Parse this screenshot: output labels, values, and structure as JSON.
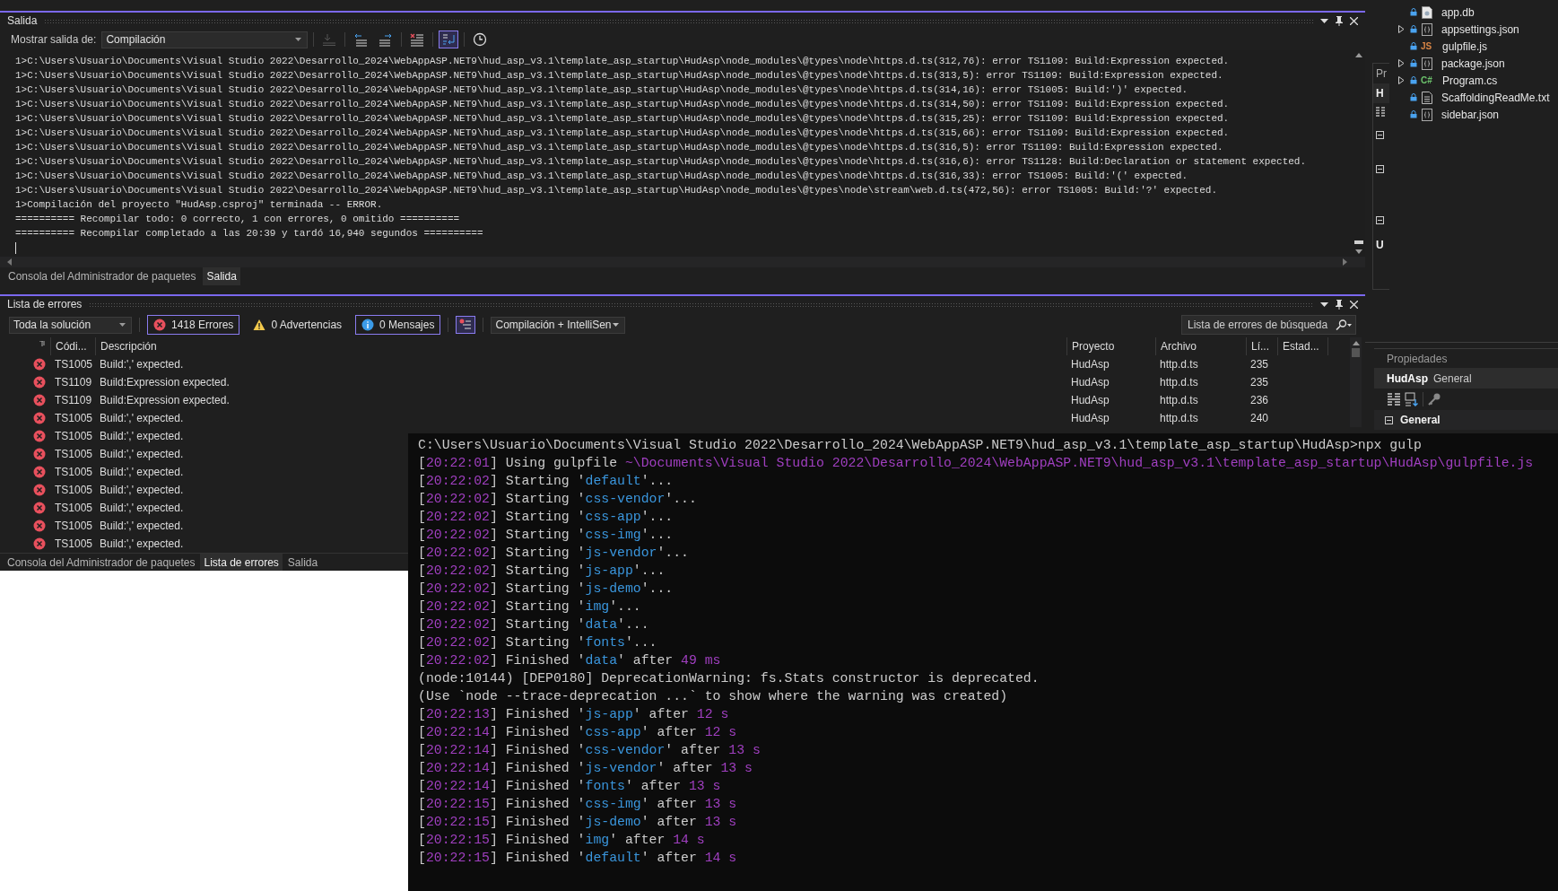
{
  "output_panel": {
    "title": "Salida",
    "show_from_label": "Mostrar salida de:",
    "source": "Compilación",
    "toolbar": [
      {
        "kind": "find-source",
        "selected": false,
        "disabled": true
      },
      {
        "kind": "prev-message",
        "selected": false,
        "disabled": false
      },
      {
        "kind": "next-message",
        "selected": false,
        "disabled": false
      },
      {
        "kind": "clear-all",
        "selected": false,
        "disabled": false
      },
      {
        "kind": "word-wrap",
        "selected": true,
        "disabled": false
      },
      {
        "kind": "timestamp",
        "selected": false,
        "disabled": false
      }
    ],
    "lines": [
      "1>C:\\Users\\Usuario\\Documents\\Visual Studio 2022\\Desarrollo_2024\\WebAppASP.NET9\\hud_asp_v3.1\\template_asp_startup\\HudAsp\\node_modules\\@types\\node\\https.d.ts(312,76): error TS1109: Build:Expression expected.",
      "1>C:\\Users\\Usuario\\Documents\\Visual Studio 2022\\Desarrollo_2024\\WebAppASP.NET9\\hud_asp_v3.1\\template_asp_startup\\HudAsp\\node_modules\\@types\\node\\https.d.ts(313,5): error TS1109: Build:Expression expected.",
      "1>C:\\Users\\Usuario\\Documents\\Visual Studio 2022\\Desarrollo_2024\\WebAppASP.NET9\\hud_asp_v3.1\\template_asp_startup\\HudAsp\\node_modules\\@types\\node\\https.d.ts(314,16): error TS1005: Build:')' expected.",
      "1>C:\\Users\\Usuario\\Documents\\Visual Studio 2022\\Desarrollo_2024\\WebAppASP.NET9\\hud_asp_v3.1\\template_asp_startup\\HudAsp\\node_modules\\@types\\node\\https.d.ts(314,50): error TS1109: Build:Expression expected.",
      "1>C:\\Users\\Usuario\\Documents\\Visual Studio 2022\\Desarrollo_2024\\WebAppASP.NET9\\hud_asp_v3.1\\template_asp_startup\\HudAsp\\node_modules\\@types\\node\\https.d.ts(315,25): error TS1109: Build:Expression expected.",
      "1>C:\\Users\\Usuario\\Documents\\Visual Studio 2022\\Desarrollo_2024\\WebAppASP.NET9\\hud_asp_v3.1\\template_asp_startup\\HudAsp\\node_modules\\@types\\node\\https.d.ts(315,66): error TS1109: Build:Expression expected.",
      "1>C:\\Users\\Usuario\\Documents\\Visual Studio 2022\\Desarrollo_2024\\WebAppASP.NET9\\hud_asp_v3.1\\template_asp_startup\\HudAsp\\node_modules\\@types\\node\\https.d.ts(316,5): error TS1109: Build:Expression expected.",
      "1>C:\\Users\\Usuario\\Documents\\Visual Studio 2022\\Desarrollo_2024\\WebAppASP.NET9\\hud_asp_v3.1\\template_asp_startup\\HudAsp\\node_modules\\@types\\node\\https.d.ts(316,6): error TS1128: Build:Declaration or statement expected.",
      "1>C:\\Users\\Usuario\\Documents\\Visual Studio 2022\\Desarrollo_2024\\WebAppASP.NET9\\hud_asp_v3.1\\template_asp_startup\\HudAsp\\node_modules\\@types\\node\\https.d.ts(316,33): error TS1005: Build:'(' expected.",
      "1>C:\\Users\\Usuario\\Documents\\Visual Studio 2022\\Desarrollo_2024\\WebAppASP.NET9\\hud_asp_v3.1\\template_asp_startup\\HudAsp\\node_modules\\@types\\node\\stream\\web.d.ts(472,56): error TS1005: Build:'?' expected.",
      "1>Compilación del proyecto \"HudAsp.csproj\" terminada -- ERROR.",
      "========== Recompilar todo: 0 correcto, 1 con errores, 0 omitido ==========",
      "========== Recompilar completado a las 20:39 y tardó 16,940 segundos =========="
    ],
    "tabs": [
      {
        "label": "Consola del Administrador de paquetes",
        "selected": false
      },
      {
        "label": "Salida",
        "selected": true
      }
    ]
  },
  "error_list": {
    "title": "Lista de errores",
    "scope": "Toda la solución",
    "filters": [
      {
        "kind": "error",
        "label": "1418 Errores",
        "selected": true
      },
      {
        "kind": "warning",
        "label": "0 Advertencias",
        "selected": false
      },
      {
        "kind": "info",
        "label": "0 Mensajes",
        "selected": true
      }
    ],
    "filter_toggle_selected": true,
    "source": "Compilación + IntelliSen",
    "search_placeholder": "Lista de errores de búsqueda",
    "columns": [
      "Códi...",
      "Descripción",
      "Proyecto",
      "Archivo",
      "Lí...",
      "Estad..."
    ],
    "rows": [
      {
        "kind": "error",
        "code": "TS1005",
        "description": "Build:',' expected.",
        "project": "HudAsp",
        "file": "http.d.ts",
        "line": "235"
      },
      {
        "kind": "error",
        "code": "TS1109",
        "description": "Build:Expression expected.",
        "project": "HudAsp",
        "file": "http.d.ts",
        "line": "235"
      },
      {
        "kind": "error",
        "code": "TS1109",
        "description": "Build:Expression expected.",
        "project": "HudAsp",
        "file": "http.d.ts",
        "line": "236"
      },
      {
        "kind": "error",
        "code": "TS1005",
        "description": "Build:',' expected.",
        "project": "HudAsp",
        "file": "http.d.ts",
        "line": "240"
      },
      {
        "kind": "error",
        "code": "TS1005",
        "description": "Build:',' expected."
      },
      {
        "kind": "error",
        "code": "TS1005",
        "description": "Build:',' expected."
      },
      {
        "kind": "error",
        "code": "TS1005",
        "description": "Build:',' expected."
      },
      {
        "kind": "error",
        "code": "TS1005",
        "description": "Build:',' expected."
      },
      {
        "kind": "error",
        "code": "TS1005",
        "description": "Build:',' expected."
      },
      {
        "kind": "error",
        "code": "TS1005",
        "description": "Build:',' expected."
      },
      {
        "kind": "error",
        "code": "TS1005",
        "description": "Build:',' expected."
      }
    ],
    "tabs": [
      {
        "label": "Consola del Administrador de paquetes",
        "selected": false
      },
      {
        "label": "Lista de errores",
        "selected": true
      },
      {
        "label": "Salida",
        "selected": false
      }
    ]
  },
  "solution_explorer": {
    "items": [
      {
        "name": "app.db",
        "kind": "db",
        "has_children": false,
        "locked": true
      },
      {
        "name": "appsettings.json",
        "kind": "json",
        "has_children": true,
        "locked": true
      },
      {
        "name": "gulpfile.js",
        "kind": "js",
        "badge": "JS",
        "has_children": false,
        "locked": true
      },
      {
        "name": "package.json",
        "kind": "json",
        "has_children": true,
        "locked": true
      },
      {
        "name": "Program.cs",
        "kind": "cs",
        "badge": "C#",
        "has_children": true,
        "locked": true
      },
      {
        "name": "ScaffoldingReadMe.txt",
        "kind": "txt",
        "has_children": false,
        "locked": true
      },
      {
        "name": "sidebar.json",
        "kind": "json",
        "has_children": false,
        "locked": true
      }
    ]
  },
  "covered_panel": {
    "title": "Pr",
    "labels": [
      "H",
      "U"
    ]
  },
  "properties": {
    "title": "Propiedades",
    "object": "HudAsp",
    "object_type": "General",
    "category": "General"
  },
  "terminal": {
    "lines": [
      {
        "parts": [
          {
            "text": "C:\\Users\\Usuario\\Documents\\Visual Studio 2022\\Desarrollo_2024\\WebAppASP.NET9\\hud_asp_v3.1\\template_asp_startup\\HudAsp>npx gulp",
            "kind": "plain"
          }
        ]
      },
      {
        "parts": [
          {
            "text": "[",
            "kind": "plain"
          },
          {
            "text": "20:22:01",
            "kind": "time"
          },
          {
            "text": "] Using gulpfile ",
            "kind": "plain"
          },
          {
            "text": "~\\Documents\\Visual Studio 2022\\Desarrollo_2024\\WebAppASP.NET9\\hud_asp_v3.1\\template_asp_startup\\HudAsp\\gulpfile.js",
            "kind": "path"
          }
        ]
      },
      {
        "parts": [
          {
            "text": "[",
            "kind": "plain"
          },
          {
            "text": "20:22:02",
            "kind": "time"
          },
          {
            "text": "] Starting '",
            "kind": "plain"
          },
          {
            "text": "default",
            "kind": "task"
          },
          {
            "text": "'...",
            "kind": "plain"
          }
        ]
      },
      {
        "parts": [
          {
            "text": "[",
            "kind": "plain"
          },
          {
            "text": "20:22:02",
            "kind": "time"
          },
          {
            "text": "] Starting '",
            "kind": "plain"
          },
          {
            "text": "css-vendor",
            "kind": "task"
          },
          {
            "text": "'...",
            "kind": "plain"
          }
        ]
      },
      {
        "parts": [
          {
            "text": "[",
            "kind": "plain"
          },
          {
            "text": "20:22:02",
            "kind": "time"
          },
          {
            "text": "] Starting '",
            "kind": "plain"
          },
          {
            "text": "css-app",
            "kind": "task"
          },
          {
            "text": "'...",
            "kind": "plain"
          }
        ]
      },
      {
        "parts": [
          {
            "text": "[",
            "kind": "plain"
          },
          {
            "text": "20:22:02",
            "kind": "time"
          },
          {
            "text": "] Starting '",
            "kind": "plain"
          },
          {
            "text": "css-img",
            "kind": "task"
          },
          {
            "text": "'...",
            "kind": "plain"
          }
        ]
      },
      {
        "parts": [
          {
            "text": "[",
            "kind": "plain"
          },
          {
            "text": "20:22:02",
            "kind": "time"
          },
          {
            "text": "] Starting '",
            "kind": "plain"
          },
          {
            "text": "js-vendor",
            "kind": "task"
          },
          {
            "text": "'...",
            "kind": "plain"
          }
        ]
      },
      {
        "parts": [
          {
            "text": "[",
            "kind": "plain"
          },
          {
            "text": "20:22:02",
            "kind": "time"
          },
          {
            "text": "] Starting '",
            "kind": "plain"
          },
          {
            "text": "js-app",
            "kind": "task"
          },
          {
            "text": "'...",
            "kind": "plain"
          }
        ]
      },
      {
        "parts": [
          {
            "text": "[",
            "kind": "plain"
          },
          {
            "text": "20:22:02",
            "kind": "time"
          },
          {
            "text": "] Starting '",
            "kind": "plain"
          },
          {
            "text": "js-demo",
            "kind": "task"
          },
          {
            "text": "'...",
            "kind": "plain"
          }
        ]
      },
      {
        "parts": [
          {
            "text": "[",
            "kind": "plain"
          },
          {
            "text": "20:22:02",
            "kind": "time"
          },
          {
            "text": "] Starting '",
            "kind": "plain"
          },
          {
            "text": "img",
            "kind": "task"
          },
          {
            "text": "'...",
            "kind": "plain"
          }
        ]
      },
      {
        "parts": [
          {
            "text": "[",
            "kind": "plain"
          },
          {
            "text": "20:22:02",
            "kind": "time"
          },
          {
            "text": "] Starting '",
            "kind": "plain"
          },
          {
            "text": "data",
            "kind": "task"
          },
          {
            "text": "'...",
            "kind": "plain"
          }
        ]
      },
      {
        "parts": [
          {
            "text": "[",
            "kind": "plain"
          },
          {
            "text": "20:22:02",
            "kind": "time"
          },
          {
            "text": "] Starting '",
            "kind": "plain"
          },
          {
            "text": "fonts",
            "kind": "task"
          },
          {
            "text": "'...",
            "kind": "plain"
          }
        ]
      },
      {
        "parts": [
          {
            "text": "[",
            "kind": "plain"
          },
          {
            "text": "20:22:02",
            "kind": "time"
          },
          {
            "text": "] Finished '",
            "kind": "plain"
          },
          {
            "text": "data",
            "kind": "task"
          },
          {
            "text": "' after ",
            "kind": "plain"
          },
          {
            "text": "49 ms",
            "kind": "number"
          }
        ]
      },
      {
        "parts": [
          {
            "text": "(node:10144) [DEP0180] DeprecationWarning: fs.Stats constructor is deprecated.",
            "kind": "plain"
          }
        ]
      },
      {
        "parts": [
          {
            "text": "(Use `node --trace-deprecation ...` to show where the warning was created)",
            "kind": "plain"
          }
        ]
      },
      {
        "parts": [
          {
            "text": "[",
            "kind": "plain"
          },
          {
            "text": "20:22:13",
            "kind": "time"
          },
          {
            "text": "] Finished '",
            "kind": "plain"
          },
          {
            "text": "js-app",
            "kind": "task"
          },
          {
            "text": "' after ",
            "kind": "plain"
          },
          {
            "text": "12 s",
            "kind": "number"
          }
        ]
      },
      {
        "parts": [
          {
            "text": "[",
            "kind": "plain"
          },
          {
            "text": "20:22:14",
            "kind": "time"
          },
          {
            "text": "] Finished '",
            "kind": "plain"
          },
          {
            "text": "css-app",
            "kind": "task"
          },
          {
            "text": "' after ",
            "kind": "plain"
          },
          {
            "text": "12 s",
            "kind": "number"
          }
        ]
      },
      {
        "parts": [
          {
            "text": "[",
            "kind": "plain"
          },
          {
            "text": "20:22:14",
            "kind": "time"
          },
          {
            "text": "] Finished '",
            "kind": "plain"
          },
          {
            "text": "css-vendor",
            "kind": "task"
          },
          {
            "text": "' after ",
            "kind": "plain"
          },
          {
            "text": "13 s",
            "kind": "number"
          }
        ]
      },
      {
        "parts": [
          {
            "text": "[",
            "kind": "plain"
          },
          {
            "text": "20:22:14",
            "kind": "time"
          },
          {
            "text": "] Finished '",
            "kind": "plain"
          },
          {
            "text": "js-vendor",
            "kind": "task"
          },
          {
            "text": "' after ",
            "kind": "plain"
          },
          {
            "text": "13 s",
            "kind": "number"
          }
        ]
      },
      {
        "parts": [
          {
            "text": "[",
            "kind": "plain"
          },
          {
            "text": "20:22:14",
            "kind": "time"
          },
          {
            "text": "] Finished '",
            "kind": "plain"
          },
          {
            "text": "fonts",
            "kind": "task"
          },
          {
            "text": "' after ",
            "kind": "plain"
          },
          {
            "text": "13 s",
            "kind": "number"
          }
        ]
      },
      {
        "parts": [
          {
            "text": "[",
            "kind": "plain"
          },
          {
            "text": "20:22:15",
            "kind": "time"
          },
          {
            "text": "] Finished '",
            "kind": "plain"
          },
          {
            "text": "css-img",
            "kind": "task"
          },
          {
            "text": "' after ",
            "kind": "plain"
          },
          {
            "text": "13 s",
            "kind": "number"
          }
        ]
      },
      {
        "parts": [
          {
            "text": "[",
            "kind": "plain"
          },
          {
            "text": "20:22:15",
            "kind": "time"
          },
          {
            "text": "] Finished '",
            "kind": "plain"
          },
          {
            "text": "js-demo",
            "kind": "task"
          },
          {
            "text": "' after ",
            "kind": "plain"
          },
          {
            "text": "13 s",
            "kind": "number"
          }
        ]
      },
      {
        "parts": [
          {
            "text": "[",
            "kind": "plain"
          },
          {
            "text": "20:22:15",
            "kind": "time"
          },
          {
            "text": "] Finished '",
            "kind": "plain"
          },
          {
            "text": "img",
            "kind": "task"
          },
          {
            "text": "' after ",
            "kind": "plain"
          },
          {
            "text": "14 s",
            "kind": "number"
          }
        ]
      },
      {
        "parts": [
          {
            "text": "[",
            "kind": "plain"
          },
          {
            "text": "20:22:15",
            "kind": "time"
          },
          {
            "text": "] Finished '",
            "kind": "plain"
          },
          {
            "text": "default",
            "kind": "task"
          },
          {
            "text": "' after ",
            "kind": "plain"
          },
          {
            "text": "14 s",
            "kind": "number"
          }
        ]
      }
    ]
  }
}
